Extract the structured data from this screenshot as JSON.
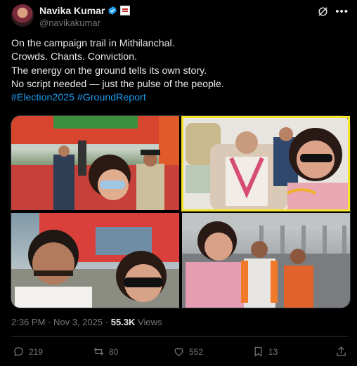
{
  "author": {
    "display_name": "Navika Kumar",
    "handle": "@navikakumar"
  },
  "header_icons": {
    "grok": "grok-icon",
    "more": "more-icon"
  },
  "tweet": {
    "lines": [
      "On the campaign trail in Mithilanchal.",
      "Crowds. Chants. Conviction.",
      "The energy on the ground tells its own story.",
      "No script needed — just the pulse of the people."
    ],
    "hashtags": [
      "#Election2025",
      "#GroundReport"
    ]
  },
  "media": {
    "photos": [
      "rally-stage-selfie",
      "helicopter-selfie",
      "helicopter-side-selfie",
      "airstrip-group-photo"
    ],
    "highlight_color": "#f5e42a"
  },
  "meta": {
    "time": "2:36 PM",
    "date": "Nov 3, 2025",
    "views_count": "55.3K",
    "views_label": "Views"
  },
  "actions": {
    "replies": "219",
    "reposts": "80",
    "likes": "552",
    "bookmarks": "13"
  },
  "colors": {
    "accent": "#1d9bf0",
    "background": "#000000",
    "muted": "#71767b"
  }
}
